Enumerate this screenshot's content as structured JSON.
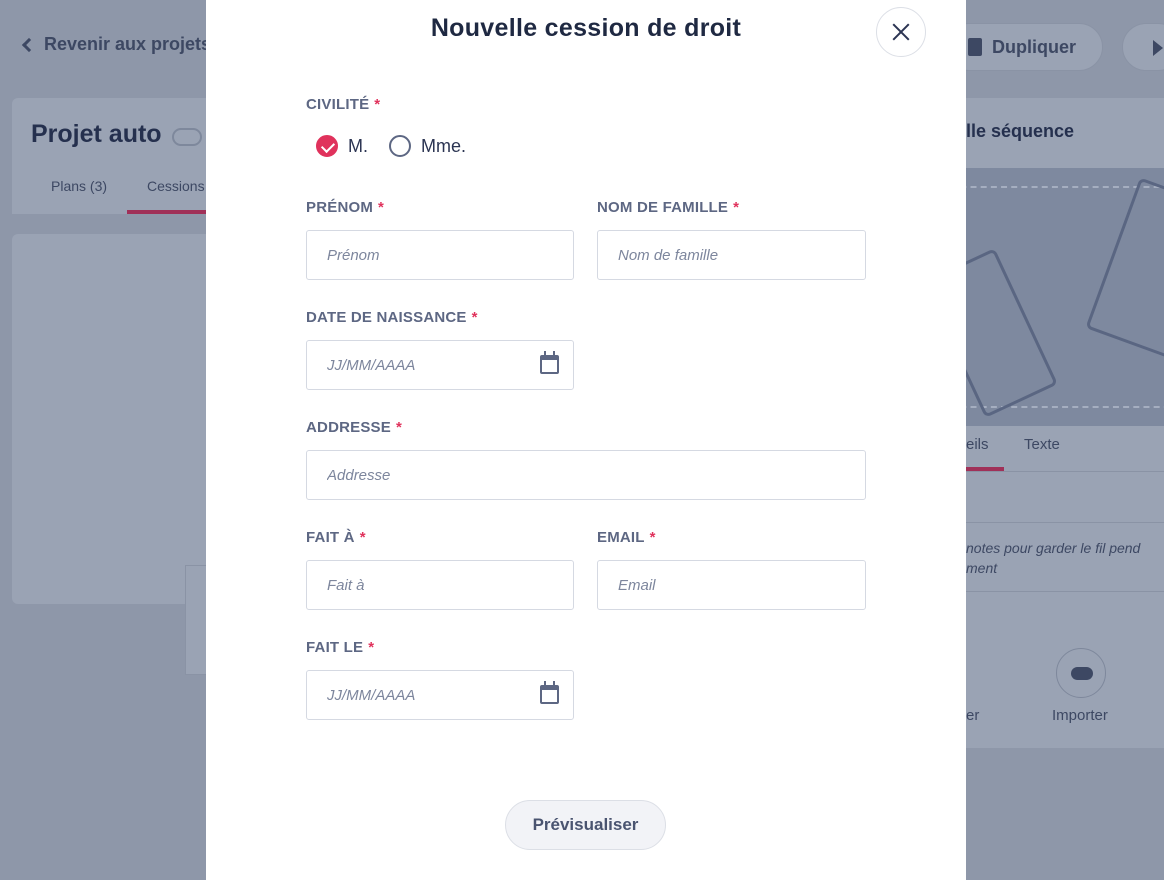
{
  "background": {
    "back_link": "Revenir aux projets",
    "project_title": "Projet auto",
    "project_tabs": [
      "Plans (3)",
      "Cessions"
    ],
    "duplicate_button": "Dupliquer",
    "sequence_title": "lle séquence",
    "right_tabs": [
      "eils",
      "Texte"
    ],
    "notes_text": "notes pour garder le fil pend\nment",
    "actions": [
      "er",
      "Importer"
    ]
  },
  "modal": {
    "title": "Nouvelle cession de droit",
    "civility": {
      "label": "CIVILITÉ",
      "options": [
        {
          "label": "M.",
          "checked": true
        },
        {
          "label": "Mme.",
          "checked": false
        }
      ]
    },
    "fields": {
      "first_name": {
        "label": "PRÉNOM",
        "placeholder": "Prénom",
        "value": ""
      },
      "last_name": {
        "label": "NOM DE FAMILLE",
        "placeholder": "Nom de famille",
        "value": ""
      },
      "birth_date": {
        "label": "DATE DE NAISSANCE",
        "placeholder": "JJ/MM/AAAA",
        "value": ""
      },
      "address": {
        "label": "ADDRESSE",
        "placeholder": "Addresse",
        "value": ""
      },
      "made_at": {
        "label": "FAIT À",
        "placeholder": "Fait à",
        "value": ""
      },
      "email": {
        "label": "EMAIL",
        "placeholder": "Email",
        "value": ""
      },
      "made_on": {
        "label": "FAIT LE",
        "placeholder": "JJ/MM/AAAA",
        "value": ""
      }
    },
    "required_mark": "*",
    "preview_button": "Prévisualiser"
  },
  "colors": {
    "accent": "#e0325c",
    "title": "#1f2942",
    "label": "#5d6783",
    "overlay": "#8e97a9"
  }
}
